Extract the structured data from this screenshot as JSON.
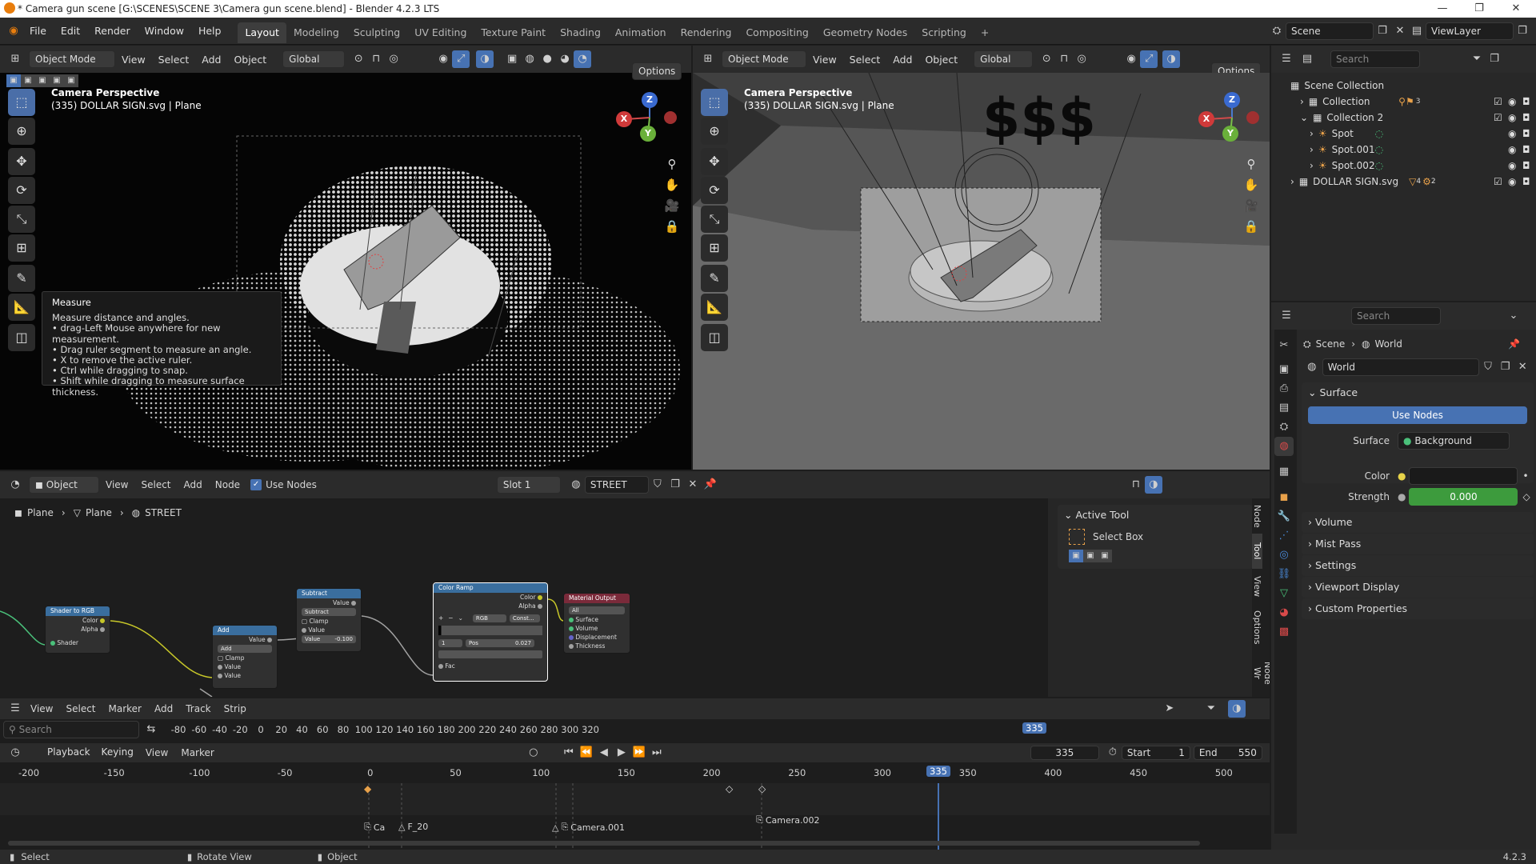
{
  "window": {
    "title": "* Camera gun scene [G:\\SCENES\\SCENE 3\\Camera gun scene.blend] - Blender 4.2.3 LTS",
    "minimize": "—",
    "maximize": "❐",
    "close": "✕"
  },
  "menu": [
    "File",
    "Edit",
    "Render",
    "Window",
    "Help"
  ],
  "workspaces": [
    "Layout",
    "Modeling",
    "Sculpting",
    "UV Editing",
    "Texture Paint",
    "Shading",
    "Animation",
    "Rendering",
    "Compositing",
    "Geometry Nodes",
    "Scripting"
  ],
  "add_workspace": "+",
  "scene": {
    "name": "Scene",
    "view_layer": "ViewLayer"
  },
  "viewport_left": {
    "mode": "Object Mode",
    "menu": [
      "View",
      "Select",
      "Add",
      "Object"
    ],
    "orientation": "Global",
    "options": "Options",
    "overlay_title": "Camera Perspective",
    "overlay_sub": "(335) DOLLAR SIGN.svg | Plane",
    "tooltip": {
      "title": "Measure",
      "lines": [
        "Measure distance and angles.",
        "• drag-Left Mouse anywhere for new measurement.",
        "• Drag ruler segment to measure an angle.",
        "• X to remove the active ruler.",
        "• Ctrl while dragging to snap.",
        "• Shift while dragging to measure surface thickness."
      ]
    }
  },
  "viewport_right": {
    "mode": "Object Mode",
    "menu": [
      "View",
      "Select",
      "Add",
      "Object"
    ],
    "orientation": "Global",
    "options": "Options",
    "overlay_title": "Camera Perspective",
    "overlay_sub": "(335) DOLLAR SIGN.svg | Plane",
    "sign_text": "$$$"
  },
  "axes": {
    "x": "X",
    "y": "Y",
    "z": "Z"
  },
  "outliner": {
    "search_placeholder": "Search",
    "rows": [
      {
        "label": "Scene Collection",
        "indent": 0
      },
      {
        "label": "Collection",
        "indent": 1
      },
      {
        "label": "Collection 2",
        "indent": 1
      },
      {
        "label": "Spot",
        "indent": 2
      },
      {
        "label": "Spot.001",
        "indent": 2
      },
      {
        "label": "Spot.002",
        "indent": 2
      },
      {
        "label": "DOLLAR SIGN.svg",
        "indent": 1
      }
    ],
    "badges": {
      "collection_count": "3",
      "dollar_a": "4",
      "dollar_b": "2"
    }
  },
  "properties": {
    "search_placeholder": "Search",
    "breadcrumb": [
      "Scene",
      "World"
    ],
    "world_name": "World",
    "surface_label": "Surface",
    "use_nodes": "Use Nodes",
    "surface_field_label": "Surface",
    "surface_value": "Background",
    "color_label": "Color",
    "strength_label": "Strength",
    "strength_value": "0.000",
    "sections": [
      "Volume",
      "Mist Pass",
      "Settings",
      "Viewport Display",
      "Custom Properties"
    ]
  },
  "node_editor": {
    "type": "Object",
    "menu": [
      "View",
      "Select",
      "Add",
      "Node"
    ],
    "use_nodes": "Use Nodes",
    "slot": "Slot 1",
    "material": "STREET",
    "breadcrumb": [
      "Plane",
      "Plane",
      "STREET"
    ],
    "active_tool_title": "Active Tool",
    "active_tool_name": "Select Box",
    "side_tabs": [
      "Node",
      "Tool",
      "View",
      "Options",
      "Node Wr"
    ],
    "nodes": {
      "shader_to_rgb": {
        "title": "Shader to RGB",
        "out1": "Color",
        "out2": "Alpha",
        "in1": "Shader"
      },
      "add": {
        "title": "Add",
        "out": "Value",
        "op": "Add",
        "clamp": "Clamp",
        "in1": "Value",
        "in2": "Value"
      },
      "subtract": {
        "title": "Subtract",
        "out": "Value",
        "op": "Subtract",
        "clamp": "Clamp",
        "in1": "Value",
        "in2_label": "Value",
        "in2_value": "-0.100"
      },
      "color_ramp": {
        "title": "Color Ramp",
        "out1": "Color",
        "out2": "Alpha",
        "mode": "RGB",
        "interp": "Const...",
        "index": "1",
        "pos_label": "Pos",
        "pos_value": "0.027",
        "in": "Fac"
      },
      "material_output": {
        "title": "Material Output",
        "target": "All",
        "in1": "Surface",
        "in2": "Volume",
        "in3": "Displacement",
        "in4": "Thickness"
      }
    }
  },
  "sequencer": {
    "menu": [
      "View",
      "Select",
      "Marker",
      "Add",
      "Track",
      "Strip"
    ],
    "search_placeholder": "Search",
    "ticks": [
      "-80",
      "-60",
      "-40",
      "-20",
      "0",
      "20",
      "40",
      "60",
      "80",
      "100",
      "120",
      "140",
      "160",
      "180",
      "200",
      "220",
      "240",
      "260",
      "280",
      "300",
      "320"
    ],
    "current": "335"
  },
  "timeline": {
    "menu": [
      "Playback",
      "Keying",
      "View",
      "Marker"
    ],
    "current_frame": "335",
    "start_label": "Start",
    "start": "1",
    "end_label": "End",
    "end": "550",
    "ticks": [
      "-200",
      "-150",
      "-100",
      "-50",
      "0",
      "50",
      "100",
      "150",
      "200",
      "250",
      "300",
      "350",
      "400",
      "450",
      "500"
    ],
    "current": "335",
    "markers": [
      "Ca",
      "F_20",
      "Camera.001",
      "Camera.002"
    ]
  },
  "statusbar": {
    "select": "Select",
    "rotate": "Rotate View",
    "object": "Object",
    "version": "4.2.3"
  },
  "colors": {
    "accent": "#4772b3",
    "header": "#2b2b2b",
    "strength_bar": "#3d9b3d"
  }
}
